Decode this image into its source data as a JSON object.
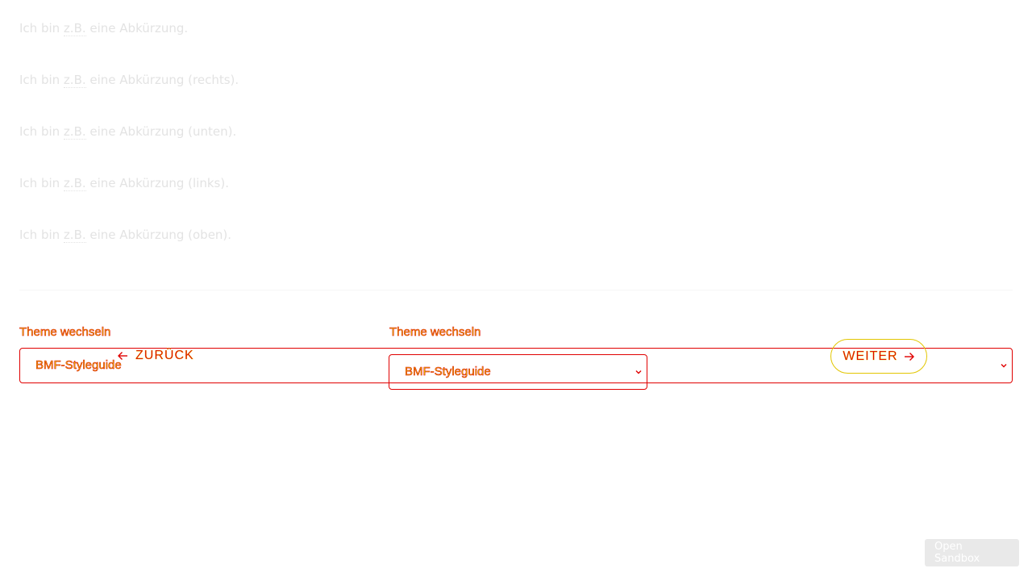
{
  "abbreviations": {
    "items": [
      {
        "prefix": "Ich bin ",
        "abbr": "z.B.",
        "suffix": " eine Abkürzung."
      },
      {
        "prefix": "Ich bin ",
        "abbr": "z.B.",
        "suffix": " eine Abkürzung (rechts)."
      },
      {
        "prefix": "Ich bin ",
        "abbr": "z.B.",
        "suffix": " eine Abkürzung (unten)."
      },
      {
        "prefix": "Ich bin ",
        "abbr": "z.B.",
        "suffix": " eine Abkürzung (links)."
      },
      {
        "prefix": "Ich bin ",
        "abbr": "z.B.",
        "suffix": " eine Abkürzung (oben)."
      }
    ]
  },
  "theme_switcher_wide": {
    "label": "Theme wechseln",
    "selected": "BMF-Styleguide"
  },
  "theme_switcher_narrow": {
    "label": "Theme wechseln",
    "selected": "BMF-Styleguide"
  },
  "navigation": {
    "back_label": "ZURÜCK",
    "back_arrow": "←",
    "next_label": "WEITER",
    "next_arrow": "→"
  },
  "sandbox": {
    "label": "Open Sandbox"
  },
  "colors": {
    "outline_red": "#e00000",
    "outline_yellow": "#e2c600",
    "faded_text": "#e3e3e3"
  },
  "icons": {
    "chevron": "chevron-down-icon",
    "arrow_left": "arrow-left-icon",
    "arrow_right": "arrow-right-icon"
  }
}
